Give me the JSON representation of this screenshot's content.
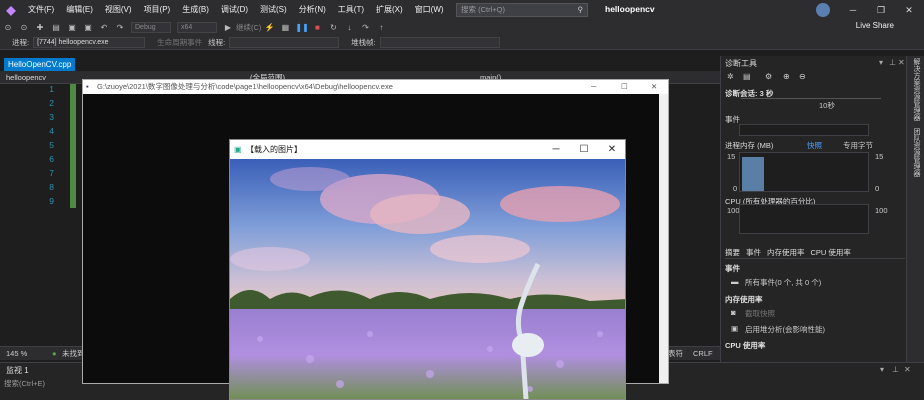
{
  "menubar": {
    "items": [
      "文件(F)",
      "编辑(E)",
      "视图(V)",
      "项目(P)",
      "生成(B)",
      "调试(D)",
      "测试(S)",
      "分析(N)",
      "工具(T)",
      "扩展(X)",
      "窗口(W)",
      "帮助(H)"
    ],
    "search_placeholder": "搜索 (Ctrl+Q)",
    "app_title": "helloopencv",
    "live_share": "Live Share"
  },
  "toolbar": {
    "config": "Debug",
    "platform": "x64",
    "continue_label": "继续(C)"
  },
  "procbar": {
    "process_label": "进程:",
    "process_value": "[7744] helloopencv.exe",
    "lifecycle_label": "生命周期事件",
    "thread_label": "线程:",
    "stackframe_label": "堆栈帧:"
  },
  "editor": {
    "tab_label": "HelloOpenCV.cpp",
    "project_nav": "helloopencv",
    "scope_nav": "(全局范围)",
    "func_nav": "main()",
    "line_numbers": [
      "1",
      "2",
      "3",
      "4",
      "5",
      "6",
      "7",
      "8",
      "9"
    ]
  },
  "console": {
    "title": "G:\\zuoye\\2021\\数字图像处理与分析\\code\\page1\\helloopencv\\x64\\Debug\\helloopencv.exe"
  },
  "image_window": {
    "title": "【载入的图片】"
  },
  "statusbar": {
    "zoom": "145 %",
    "issues": "未找到",
    "encoding": "CRLF",
    "tab_mode": "表符"
  },
  "bottom_panel": {
    "title": "监视 1",
    "search_placeholder": "搜索(Ctrl+E)"
  },
  "diag": {
    "title": "诊断工具",
    "session_label": "诊断会话: 3 秒",
    "timeline_label": "10秒",
    "events_label": "事件",
    "memory_label": "进程内存 (MB)",
    "snapshot_label": "快照",
    "private_bytes_label": "专用字节",
    "mem_max": "15",
    "mem_min": "0",
    "cpu_label": "CPU (所有处理器的百分比)",
    "cpu_max": "100",
    "tabs": [
      "摘要",
      "事件",
      "内存使用率",
      "CPU 使用率"
    ],
    "summary_events_title": "事件",
    "summary_events": "所有事件(0 个, 共 0 个)",
    "summary_memory_title": "内存使用率",
    "take_snapshot": "截取快照",
    "heap_profiling": "启用堆分析(会影响性能)",
    "summary_cpu_title": "CPU 使用率",
    "memory_level": 0.9
  },
  "sidestrip": {
    "items": [
      "解决方案资源管理器",
      "团队资源管理器"
    ]
  }
}
